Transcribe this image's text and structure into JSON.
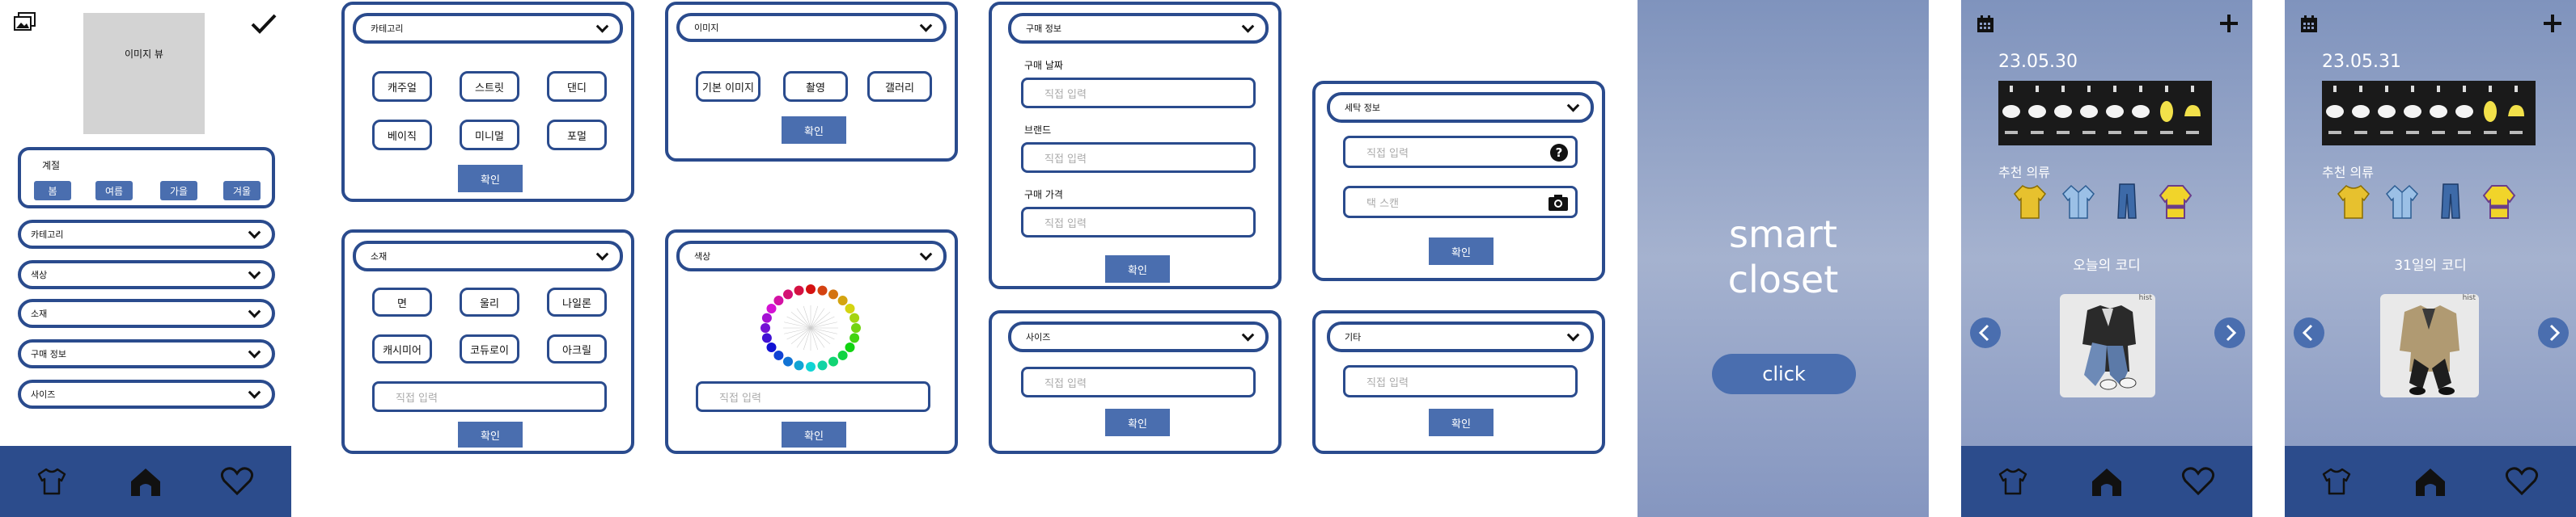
{
  "screen1": {
    "image_view_label": "이미지 뷰",
    "season_label": "계절",
    "seasons": [
      "봄",
      "여름",
      "가을",
      "겨울"
    ],
    "dropdowns": [
      "카테고리",
      "색상",
      "소재",
      "구매 정보",
      "사이즈"
    ]
  },
  "category_card": {
    "title": "카테고리",
    "options": [
      "캐주얼",
      "스트릿",
      "댄디",
      "베이직",
      "미니멀",
      "포멀"
    ],
    "confirm": "확인"
  },
  "image_card": {
    "title": "이미지",
    "options": [
      "기본 이미지",
      "촬영",
      "갤러리"
    ],
    "confirm": "확인"
  },
  "material_card": {
    "title": "소재",
    "options": [
      "면",
      "울리",
      "나일론",
      "캐시미어",
      "코듀로이",
      "아크릴"
    ],
    "input_placeholder": "직접 입력",
    "confirm": "확인"
  },
  "color_card": {
    "title": "색상",
    "input_placeholder": "직접 입력",
    "confirm": "확인"
  },
  "purchase_card": {
    "title": "구매 정보",
    "date_label": "구매 날짜",
    "brand_label": "브랜드",
    "price_label": "구매 가격",
    "date_placeholder": "직접 입력",
    "brand_placeholder": "직접 입력",
    "price_placeholder": "직접 입력",
    "confirm": "확인"
  },
  "size_card": {
    "title": "사이즈",
    "input_placeholder": "직접 입력",
    "confirm": "확인"
  },
  "laundry_card": {
    "title": "세탁 정보",
    "input_placeholder": "직접 입력",
    "scan_placeholder": "택 스캔",
    "confirm": "확인"
  },
  "etc_card": {
    "title": "기타",
    "input_placeholder": "직접 입력",
    "confirm": "확인"
  },
  "splash": {
    "title_line1": "smart",
    "title_line2": "closet",
    "button": "click"
  },
  "home1": {
    "date": "23.05.30",
    "recommend_label": "추천 의류",
    "coordi_title": "오늘의 코디",
    "hist_label": "hist"
  },
  "home2": {
    "date": "23.05.31",
    "recommend_label": "추천 의류",
    "coordi_title": "31일의 코디",
    "hist_label": "hist"
  },
  "colors": {
    "navy": "#2c4c8c",
    "button_blue": "#4a6eaf",
    "card_border": "#2a4b8d"
  }
}
